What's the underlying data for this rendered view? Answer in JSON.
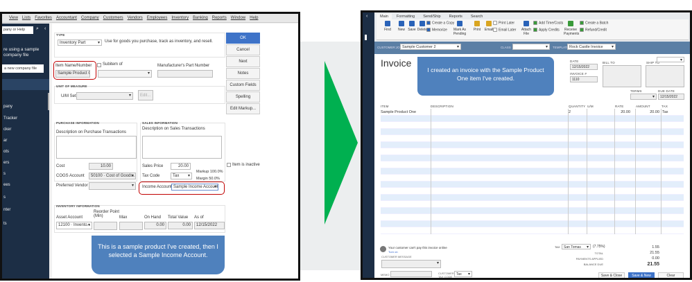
{
  "left": {
    "menu": [
      "View",
      "Lists",
      "Favorites",
      "Accountant",
      "Company",
      "Customers",
      "Vendors",
      "Employees",
      "Inventory",
      "Banking",
      "Reports",
      "Window",
      "Help"
    ],
    "search_placeholder": "pany or Help",
    "sample_line1": "re using a sample",
    "sample_line2": "company file",
    "new_company": "a new company file",
    "sidebar_items": [
      "pany",
      "Tracker",
      "cker",
      "ar",
      "ots",
      "ers",
      "s",
      "ees",
      "s",
      "nter",
      "ts"
    ],
    "type_label": "TYPE",
    "type_value": "Inventory Part",
    "type_desc": "Use for goods you purchase, track as inventory, and resell.",
    "item_name_label": "Item Name/Number",
    "item_name": "Sample Product One",
    "subitem_label": "Subitem of",
    "mfr_label": "Manufacturer's Part Number",
    "uom_label": "UNIT OF MEASURE",
    "uom_set": "U/M Set",
    "edit": "Edit...",
    "purchase_label": "PURCHASE INFORMATION",
    "purchase_desc": "Description on Purchase Transactions",
    "sales_label": "SALES INFORMATION",
    "sales_desc": "Description on Sales Transactions",
    "cost_label": "Cost",
    "cost": "10.00",
    "cogs_label": "COGS Account",
    "cogs": "50100 · Cost of Goods...",
    "vendor_label": "Preferred Vendor",
    "price_label": "Sales Price",
    "price": "20.00",
    "taxcode_label": "Tax Code",
    "taxcode": "Tax",
    "markup": "Markup  100.0%",
    "margin": "Margin  50.0%",
    "income_label": "Income Account",
    "income": "Sample Income Account",
    "inactive": "Item is inactive",
    "inv_label": "INVENTORY INFORMATION",
    "asset_label": "Asset Account",
    "asset": "12100 · Invento...",
    "reorder_label": "Reorder Point (Min)",
    "max_label": "Max",
    "onhand_label": "On Hand",
    "onhand": "0.00",
    "totalvalue_label": "Total Value",
    "totalvalue": "0.00",
    "asof_label": "As of",
    "asof": "12/15/2022",
    "buttons": [
      "OK",
      "Cancel",
      "Next",
      "Notes",
      "Custom Fields",
      "Spelling",
      "Edit Markup..."
    ],
    "callout": "This is a sample product I've created, then I selected a Sample Income Account."
  },
  "right": {
    "tabs": [
      "Main",
      "Formatting",
      "Send/Ship",
      "Reports",
      "Search"
    ],
    "toolbar": {
      "find": "Find",
      "new": "New",
      "save": "Save",
      "delete": "Delete",
      "copy": "Create a Copy",
      "memorize": "Memorize",
      "pending": "Mark As Pending",
      "print": "Print",
      "email": "Email",
      "print_later": "Print Later",
      "email_later": "Email Later",
      "attach": "Attach File",
      "time": "Add Time/Costs",
      "credits": "Apply Credits",
      "receive": "Receive Payments",
      "batch": "Create a Batch",
      "refund": "Refund/Credit"
    },
    "customer_label": "CUSTOMER:JOB",
    "customer": "Sample Customer 2",
    "class_label": "CLASS",
    "template_label": "TEMPLATE",
    "template": "Rock Castle Invoice",
    "title": "Invoice",
    "date_label": "DATE",
    "date": "12/15/2022",
    "invoice_label": "INVOICE #",
    "invoice_no": "1110",
    "billto": "BILL TO",
    "shipto": "SHIP TO",
    "terms": "TERMS",
    "due_label": "DUE DATE",
    "due": "12/15/2022",
    "columns": [
      "ITEM",
      "DESCRIPTION",
      "QUANTITY",
      "U/M",
      "RATE",
      "AMOUNT",
      "TAX"
    ],
    "line": {
      "item": "Sample Product One",
      "qty": "2",
      "rate": "20.00",
      "amount": "20.00",
      "tax": "Tax"
    },
    "pay_online": "Your customer can't pay this invoice online",
    "turn_on": "Turn on",
    "customer_message": "CUSTOMER MESSAGE",
    "memo": "MEMO",
    "cust_tax_code": "CUSTOMER TAX CODE",
    "cust_tax": "Tax",
    "tax_label": "TAX",
    "tax_region": "San Tomas",
    "tax_rate": "(7.75%)",
    "tax_amount": "1.55",
    "total_label": "TOTAL",
    "total": "21.55",
    "payments_label": "PAYMENTS APPLIED",
    "payments": "0.00",
    "balance_label": "BALANCE DUE",
    "balance": "21.55",
    "save_close": "Save & Close",
    "save_new": "Save & New",
    "clear": "Clear",
    "callout": "I created an invoice with the Sample Product One item I've created."
  },
  "colors": {
    "accent": "#4f81bd",
    "arrow": "#00b050",
    "sidebar": "#1c2e45",
    "highlight": "#c00000",
    "okbtn": "#3e73c8"
  }
}
